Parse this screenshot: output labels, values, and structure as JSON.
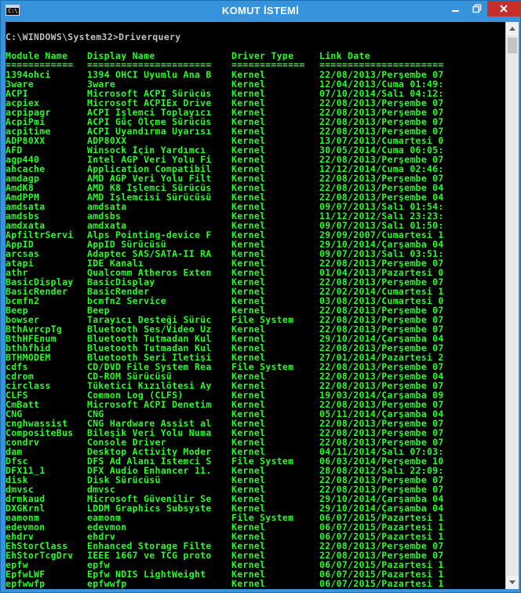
{
  "window": {
    "title": "KOMUT İSTEMİ"
  },
  "console": {
    "command_line": "C:\\WINDOWS\\System32>Driverquery",
    "headers": [
      "Module Name",
      "Display Name",
      "Driver Type",
      "Link Date"
    ],
    "separators": [
      "============",
      "======================",
      "=============",
      "======================"
    ],
    "rows": [
      [
        "1394ohci",
        "1394 OHCI Uyumlu Ana B",
        "Kernel",
        "22/08/2013/Perşembe 07"
      ],
      [
        "3ware",
        "3ware",
        "Kernel",
        "12/04/2013/Cuma 01:49:"
      ],
      [
        "ACPI",
        "Microsoft ACPI Sürücüs",
        "Kernel",
        "07/10/2014/Salı 04:12:"
      ],
      [
        "acpiex",
        "Microsoft ACPIEx Drive",
        "Kernel",
        "22/08/2013/Perşembe 07"
      ],
      [
        "acpipagr",
        "ACPI İşlemci Toplayıcı",
        "Kernel",
        "22/08/2013/Perşembe 07"
      ],
      [
        "AcpiPmi",
        "ACPI Güç Ölçme Sürücüs",
        "Kernel",
        "22/08/2013/Perşembe 07"
      ],
      [
        "acpitime",
        "ACPI Uyandırma Uyarısı",
        "Kernel",
        "22/08/2013/Perşembe 07"
      ],
      [
        "ADP80XX",
        "ADP80XX",
        "Kernel",
        "13/07/2013/Cumartesi 0"
      ],
      [
        "AFD",
        "Winsock İçin Yardımcı",
        "Kernel",
        "30/05/2014/Cuma 06:05:"
      ],
      [
        "agp440",
        "Intel AGP Veri Yolu Fi",
        "Kernel",
        "22/08/2013/Perşembe 07"
      ],
      [
        "ahcache",
        "Application Compatibil",
        "Kernel",
        "12/12/2014/Cuma 02:46:"
      ],
      [
        "amdagp",
        "AMD AGP Veri Yolu Filt",
        "Kernel",
        "22/08/2013/Perşembe 07"
      ],
      [
        "AmdK8",
        "AMD K8 İşlemci Sürücüs",
        "Kernel",
        "22/08/2013/Perşembe 04"
      ],
      [
        "AmdPPM",
        "AMD İşlemcisi Sürücüsü",
        "Kernel",
        "22/08/2013/Perşembe 04"
      ],
      [
        "amdsata",
        "amdsata",
        "Kernel",
        "09/07/2013/Salı 01:54:"
      ],
      [
        "amdsbs",
        "amdsbs",
        "Kernel",
        "11/12/2012/Salı 23:23:"
      ],
      [
        "amdxata",
        "amdxata",
        "Kernel",
        "09/07/2013/Salı 01:50:"
      ],
      [
        "ApfiltrServi",
        "Alps Pointing-device F",
        "Kernel",
        "29/09/2007/Cumartesi 1"
      ],
      [
        "AppID",
        "AppID Sürücüsü",
        "Kernel",
        "29/10/2014/Çarşamba 04"
      ],
      [
        "arcsas",
        "Adaptec SAS/SATA-II RA",
        "Kernel",
        "09/07/2013/Salı 03:51:"
      ],
      [
        "atapi",
        "IDE Kanalı",
        "Kernel",
        "22/08/2013/Perşembe 07"
      ],
      [
        "athr",
        "Qualcomm Atheros Exten",
        "Kernel",
        "01/04/2013/Pazartesi 0"
      ],
      [
        "BasicDisplay",
        "BasicDisplay",
        "Kernel",
        "22/08/2013/Perşembe 07"
      ],
      [
        "BasicRender",
        "BasicRender",
        "Kernel",
        "22/02/2014/Cumartesi 1"
      ],
      [
        "bcmfn2",
        "bcmfn2 Service",
        "Kernel",
        "03/08/2013/Cumartesi 0"
      ],
      [
        "Beep",
        "Beep",
        "Kernel",
        "22/08/2013/Perşembe 07"
      ],
      [
        "bowser",
        "Tarayıcı Desteği Sürüc",
        "File System",
        "22/08/2013/Perşembe 07"
      ],
      [
        "BthAvrcpTg",
        "Bluetooth Ses/Video Uz",
        "Kernel",
        "22/08/2013/Perşembe 07"
      ],
      [
        "BthHFEnum",
        "Bluetooth Tutmadan Kul",
        "Kernel",
        "29/10/2014/Çarşamba 04"
      ],
      [
        "bthhfhid",
        "Bluetooth Tutmadan Kul",
        "Kernel",
        "22/08/2013/Perşembe 07"
      ],
      [
        "BTHMODEM",
        "Bluetooth Seri İletişi",
        "Kernel",
        "27/01/2014/Pazartesi 2"
      ],
      [
        "cdfs",
        "CD/DVD File System Rea",
        "File System",
        "22/08/2013/Perşembe 07"
      ],
      [
        "cdrom",
        "CD-ROM Sürücüsü",
        "Kernel",
        "22/08/2013/Perşembe 04"
      ],
      [
        "circlass",
        "Tüketici Kızılötesi Ay",
        "Kernel",
        "22/08/2013/Perşembe 07"
      ],
      [
        "CLFS",
        "Common Log (CLFS)",
        "Kernel",
        "19/03/2014/Çarşamba 09"
      ],
      [
        "CmBatt",
        "Microsoft ACPI Denetim",
        "Kernel",
        "22/08/2013/Perşembe 07"
      ],
      [
        "CNG",
        "CNG",
        "Kernel",
        "05/11/2014/Çarşamba 04"
      ],
      [
        "cnghwassist",
        "CNG Hardware Assist al",
        "Kernel",
        "22/08/2013/Perşembe 07"
      ],
      [
        "CompositeBus",
        "Bileşik Veri Yolu Numa",
        "Kernel",
        "22/08/2013/Perşembe 07"
      ],
      [
        "condrv",
        "Console Driver",
        "Kernel",
        "22/08/2013/Perşembe 07"
      ],
      [
        "dam",
        "Desktop Activity Moder",
        "Kernel",
        "04/11/2014/Salı 07:03:"
      ],
      [
        "Dfsc",
        "DFS Ad Alanı İstemci S",
        "File System",
        "06/03/2014/Perşembe 10"
      ],
      [
        "DFX11_1",
        "DFX Audio Enhancer 11.",
        "Kernel",
        "28/08/2012/Salı 22:09:"
      ],
      [
        "disk",
        "Disk Sürücüsü",
        "Kernel",
        "22/08/2013/Perşembe 07"
      ],
      [
        "dmvsc",
        "dmvsc",
        "Kernel",
        "22/08/2013/Perşembe 07"
      ],
      [
        "drmkaud",
        "Microsoft Güvenilir Se",
        "Kernel",
        "29/10/2014/Çarşamba 04"
      ],
      [
        "DXGKrnl",
        "LDDM Graphics Subsyste",
        "Kernel",
        "29/10/2014/Çarşamba 04"
      ],
      [
        "eamonm",
        "eamonm",
        "File System",
        "06/07/2015/Pazartesi 1"
      ],
      [
        "edevmon",
        "edevmon",
        "Kernel",
        "06/07/2015/Pazartesi 1"
      ],
      [
        "ehdrv",
        "ehdrv",
        "Kernel",
        "06/07/2015/Pazartesi 1"
      ],
      [
        "EhStorClass",
        "Enhanced Storage Filte",
        "Kernel",
        "22/08/2013/Perşembe 07"
      ],
      [
        "EhStorTcgDrv",
        "IEEE 1667 ve TCG proto",
        "Kernel",
        "22/08/2013/Perşembe 07"
      ],
      [
        "epfw",
        "epfw",
        "Kernel",
        "06/07/2015/Pazartesi 1"
      ],
      [
        "EpfwLWF",
        "Epfw NDIS LightWeight",
        "Kernel",
        "06/07/2015/Pazartesi 1"
      ],
      [
        "epfwwfp",
        "epfwwfp",
        "Kernel",
        "06/07/2015/Pazartesi 1"
      ]
    ]
  },
  "icons": {
    "app": "cmd-icon",
    "minimize": "minimize-icon",
    "maximize": "restore-icon",
    "close": "close-icon",
    "scroll_up": "arrow-up-icon",
    "scroll_down": "arrow-down-icon"
  },
  "colors": {
    "titlebar": "#3793dc",
    "close": "#c7302a",
    "console_bg": "#000000",
    "text_green": "#22ff22",
    "text_gray": "#c0c0c0"
  }
}
